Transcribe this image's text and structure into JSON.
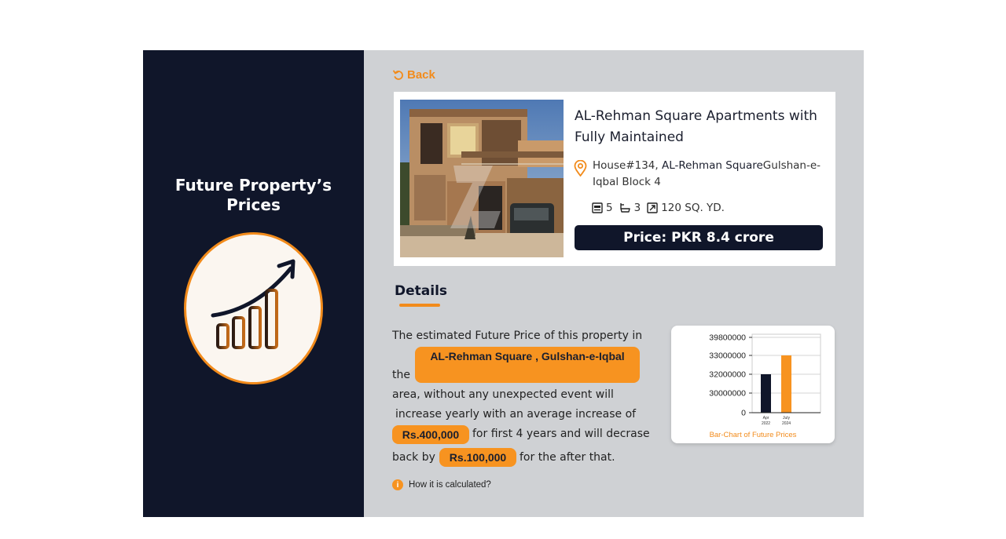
{
  "left": {
    "title": "Future Property’s Prices",
    "icon": "growth-chart-icon"
  },
  "nav": {
    "back_label": "Back"
  },
  "property": {
    "title": "AL-Rehman Square Apartments with Fully Maintained",
    "address_prefix": "House#134, ",
    "address_bold": "AL-Rehman Square",
    "address_suffix": "Gulshan-e-Iqbal Block 4",
    "beds": "5",
    "baths": "3",
    "area": "120 SQ. YD.",
    "price": "Price: PKR 8.4 crore"
  },
  "details": {
    "heading": "Details",
    "line1": "The estimated Future Price of this property in",
    "line2_prefix": "the",
    "location": "AL-Rehman Square , Gulshan-e-Iqbal",
    "line3": "area, without any unexpected event will",
    "line4": "increase yearly with an average increase of",
    "increase_amount": "Rs.400,000",
    "line5_suffix": "for first 4 years and will decrase",
    "line6_prefix": "back by",
    "decrease_amount": "Rs.100,000",
    "line6_suffix": "for the after that.",
    "info_label": "How it is calculated?"
  },
  "colors": {
    "navy": "#10162a",
    "orange": "#f79320",
    "panel_gray": "#cfd1d4"
  },
  "chart_data": {
    "type": "bar",
    "caption": "Bar-Chart of Future Prices",
    "y_tick_labels": [
      "39800000",
      "33000000",
      "32000000",
      "30000000",
      "0"
    ],
    "categories": [
      "Apr 2022",
      "July 2024"
    ],
    "values": [
      32000000,
      33000000
    ],
    "bar_colors": [
      "#10162a",
      "#f79320"
    ],
    "grid": true
  }
}
